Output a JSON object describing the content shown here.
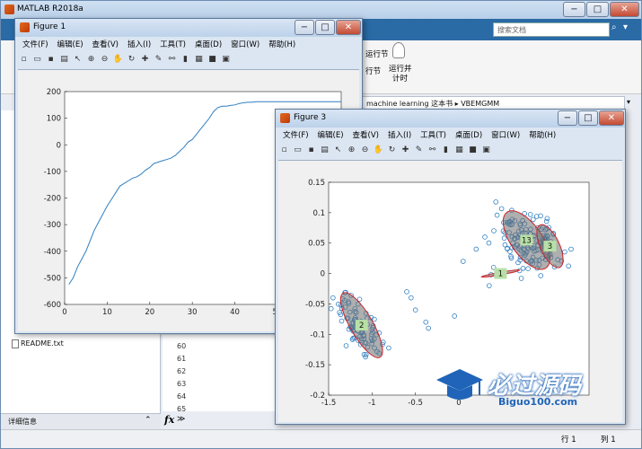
{
  "app": {
    "title": "MATLAB R2018a",
    "search_placeholder": "搜索文档",
    "ribbon_buttons": [
      "运行节",
      "运行并\n计时"
    ],
    "ribbon_label_a": "运行节",
    "ribbon_label_b": "行节",
    "ribbon_label_c": "运行并",
    "ribbon_label_d": "计时",
    "path": "machine learning 这本书  ▸  VBEMGMM",
    "readme": "README.txt",
    "detail_label": "详细信息",
    "line_numbers": [
      "60",
      "61",
      "62",
      "63",
      "64",
      "65"
    ],
    "fx": "fx",
    "status_row": "行 1",
    "status_col": "列 1"
  },
  "figure1": {
    "title": "Figure 1",
    "menu": [
      "文件(F)",
      "编辑(E)",
      "查看(V)",
      "插入(I)",
      "工具(T)",
      "桌面(D)",
      "窗口(W)",
      "帮助(H)"
    ],
    "chart_data": {
      "type": "line",
      "x": [
        1,
        2,
        3,
        4,
        5,
        6,
        7,
        8,
        9,
        10,
        11,
        12,
        13,
        14,
        15,
        16,
        17,
        18,
        19,
        20,
        21,
        22,
        23,
        24,
        25,
        26,
        27,
        28,
        29,
        30,
        31,
        32,
        33,
        34,
        35,
        36,
        37,
        38,
        39,
        40,
        41,
        42,
        43,
        44,
        45,
        46,
        47,
        48,
        49,
        50,
        51,
        52,
        53,
        54,
        55,
        56,
        57,
        58,
        59,
        60,
        61,
        62,
        63,
        64,
        65
      ],
      "y": [
        -525,
        -500,
        -460,
        -430,
        -400,
        -360,
        -320,
        -290,
        -260,
        -230,
        -205,
        -180,
        -155,
        -145,
        -135,
        -125,
        -120,
        -110,
        -95,
        -85,
        -70,
        -65,
        -60,
        -55,
        -50,
        -40,
        -25,
        -10,
        10,
        20,
        40,
        60,
        80,
        100,
        125,
        140,
        145,
        145,
        148,
        150,
        155,
        158,
        160,
        160,
        162,
        162,
        162,
        162,
        162,
        162,
        162,
        162,
        162,
        162,
        162,
        162,
        162,
        162,
        162,
        162,
        162,
        162,
        162,
        162,
        162
      ],
      "xlim": [
        0,
        65
      ],
      "ylim": [
        -600,
        200
      ],
      "xticks": [
        0,
        10,
        20,
        30,
        40,
        50
      ],
      "yticks": [
        200,
        100,
        0,
        -100,
        -200,
        -300,
        -400,
        -500,
        -600
      ],
      "line_color": "#2f7fc1"
    }
  },
  "figure3": {
    "title": "Figure 3",
    "menu": [
      "文件(F)",
      "编辑(E)",
      "查看(V)",
      "插入(I)",
      "工具(T)",
      "桌面(D)",
      "窗口(W)",
      "帮助(H)"
    ],
    "chart_data": {
      "type": "scatter",
      "xlim": [
        -1.5,
        1.5
      ],
      "ylim": [
        -0.2,
        0.15
      ],
      "xticks": [
        -1.5,
        -1,
        -0.5,
        0
      ],
      "xtick_labels": [
        "-1.5",
        "-1",
        "-0.5",
        "0"
      ],
      "yticks": [
        0.15,
        0.1,
        0.05,
        0,
        -0.05,
        -0.1,
        -0.15,
        -0.2
      ],
      "ytick_labels": [
        "0.15",
        "0.1",
        "0.05",
        "0",
        "-0.05",
        "-0.1",
        "-0.15",
        "-0.2"
      ],
      "point_color": "#2f7fc1",
      "clusters": [
        {
          "label": "2",
          "cx": -1.12,
          "cy": -0.085,
          "rx": 0.26,
          "ry": 0.038,
          "angle": -30,
          "n": 90,
          "sx": 0.17,
          "sy": 0.03
        },
        {
          "label": "13",
          "cx": 0.78,
          "cy": 0.055,
          "rx": 0.36,
          "ry": 0.035,
          "angle": -35,
          "n": 110,
          "sx": 0.25,
          "sy": 0.03
        },
        {
          "label": "3",
          "cx": 1.05,
          "cy": 0.045,
          "rx": 0.22,
          "ry": 0.024,
          "angle": -25,
          "n": 30,
          "sx": 0.18,
          "sy": 0.02
        },
        {
          "label": "1",
          "cx": 0.48,
          "cy": 0.0,
          "rx": 0.03,
          "ry": 0.02,
          "angle": 80,
          "n": 3,
          "sx": 0.02,
          "sy": 0.01
        }
      ],
      "stray_points": [
        [
          -0.55,
          -0.04
        ],
        [
          -0.38,
          -0.08
        ],
        [
          -0.35,
          -0.09
        ],
        [
          -0.5,
          -0.06
        ],
        [
          -0.05,
          -0.07
        ],
        [
          0.05,
          0.02
        ],
        [
          0.2,
          0.04
        ],
        [
          0.3,
          0.06
        ],
        [
          0.35,
          -0.02
        ],
        [
          0.4,
          0.01
        ],
        [
          -0.6,
          -0.03
        ],
        [
          -1.45,
          -0.04
        ]
      ]
    }
  },
  "watermark": {
    "main": "必过源码",
    "sub": "Biguo100.com"
  }
}
